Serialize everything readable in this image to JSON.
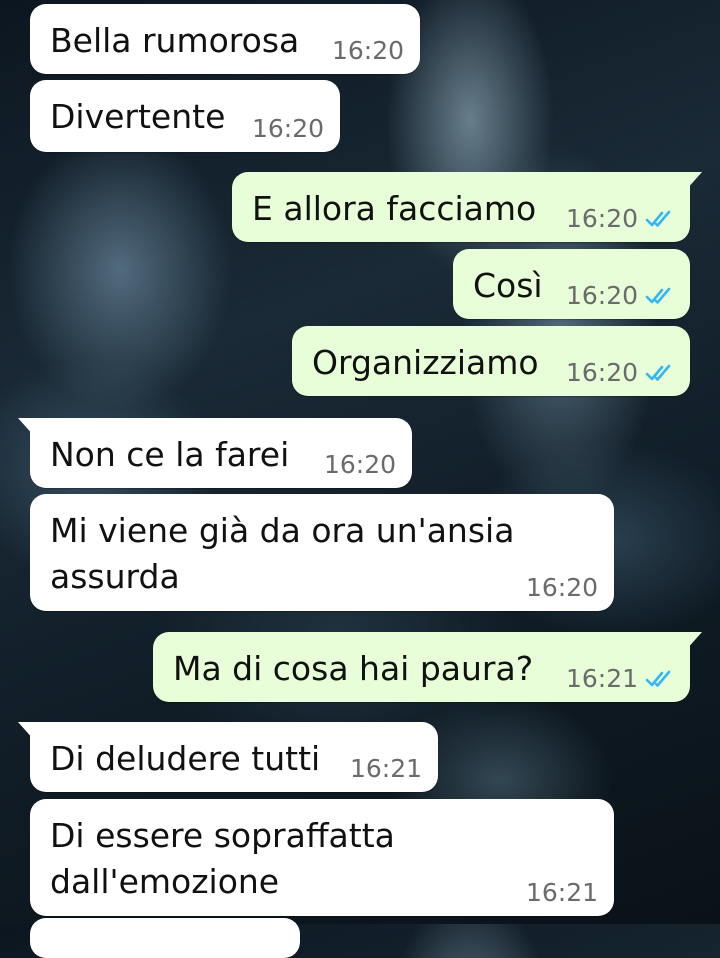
{
  "messages": [
    {
      "text": "Bella rumorosa",
      "time": "16:20"
    },
    {
      "text": "Divertente",
      "time": "16:20"
    },
    {
      "text": "E allora facciamo",
      "time": "16:20"
    },
    {
      "text": "Così",
      "time": "16:20"
    },
    {
      "text": "Organizziamo",
      "time": "16:20"
    },
    {
      "text": "Non ce la farei",
      "time": "16:20"
    },
    {
      "text": "Mi viene già da ora un'ansia assurda",
      "time": "16:20"
    },
    {
      "text": "Ma di cosa hai paura?",
      "time": "16:21"
    },
    {
      "text": "Di deludere tutti",
      "time": "16:21"
    },
    {
      "text": "Di essere sopraffatta dall'emozione",
      "time": "16:21"
    }
  ],
  "colors": {
    "incoming_bubble": "#ffffff",
    "outgoing_bubble": "#e7fed8",
    "read_ticks": "#34b7f1",
    "timestamp": "#6b6b6b"
  },
  "icons": {
    "read_receipt": "double-check-icon"
  }
}
